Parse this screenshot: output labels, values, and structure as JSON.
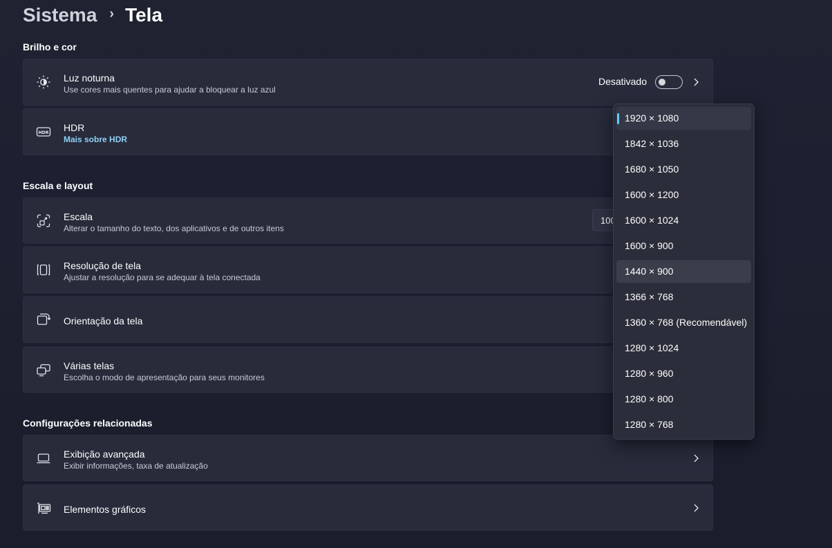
{
  "breadcrumb": {
    "parent": "Sistema",
    "separator": "›",
    "current": "Tela"
  },
  "sections": {
    "brightness": "Brilho e cor",
    "scale_layout": "Escala e layout",
    "related": "Configurações relacionadas"
  },
  "night_light": {
    "title": "Luz noturna",
    "subtitle": "Use cores mais quentes para ajudar a bloquear a luz azul",
    "state": "Desativado",
    "icon": "brightness-moon-icon"
  },
  "hdr": {
    "title": "HDR",
    "link": "Mais sobre HDR",
    "icon": "hdr-icon"
  },
  "scale": {
    "title": "Escala",
    "subtitle": "Alterar o tamanho do texto, dos aplicativos e de outros itens",
    "value": "100",
    "icon": "scale-icon"
  },
  "resolution": {
    "title": "Resolução de tela",
    "subtitle": "Ajustar a resolução para se adequar à tela conectada",
    "icon": "resolution-icon"
  },
  "orientation": {
    "title": "Orientação da tela",
    "icon": "orientation-icon"
  },
  "multiple_displays": {
    "title": "Várias telas",
    "subtitle": "Escolha o modo de apresentação para seus monitores",
    "icon": "multiple-displays-icon"
  },
  "advanced_display": {
    "title": "Exibição avançada",
    "subtitle": "Exibir informações, taxa de atualização",
    "icon": "laptop-icon"
  },
  "graphics": {
    "title": "Elementos gráficos",
    "icon": "graphics-card-icon"
  },
  "resolution_dropdown": {
    "selected": "1920 × 1080",
    "options": [
      "1920 × 1080",
      "1842 × 1036",
      "1680 × 1050",
      "1600 × 1200",
      "1600 × 1024",
      "1600 × 900",
      "1440 × 900",
      "1366 × 768",
      "1360 × 768 (Recomendável)",
      "1280 × 1024",
      "1280 × 960",
      "1280 × 800",
      "1280 × 768"
    ]
  },
  "colors": {
    "accent": "#60cdff",
    "link": "#8fd0f5",
    "card_background": "#272b3a",
    "page_background": "#1c2030"
  }
}
